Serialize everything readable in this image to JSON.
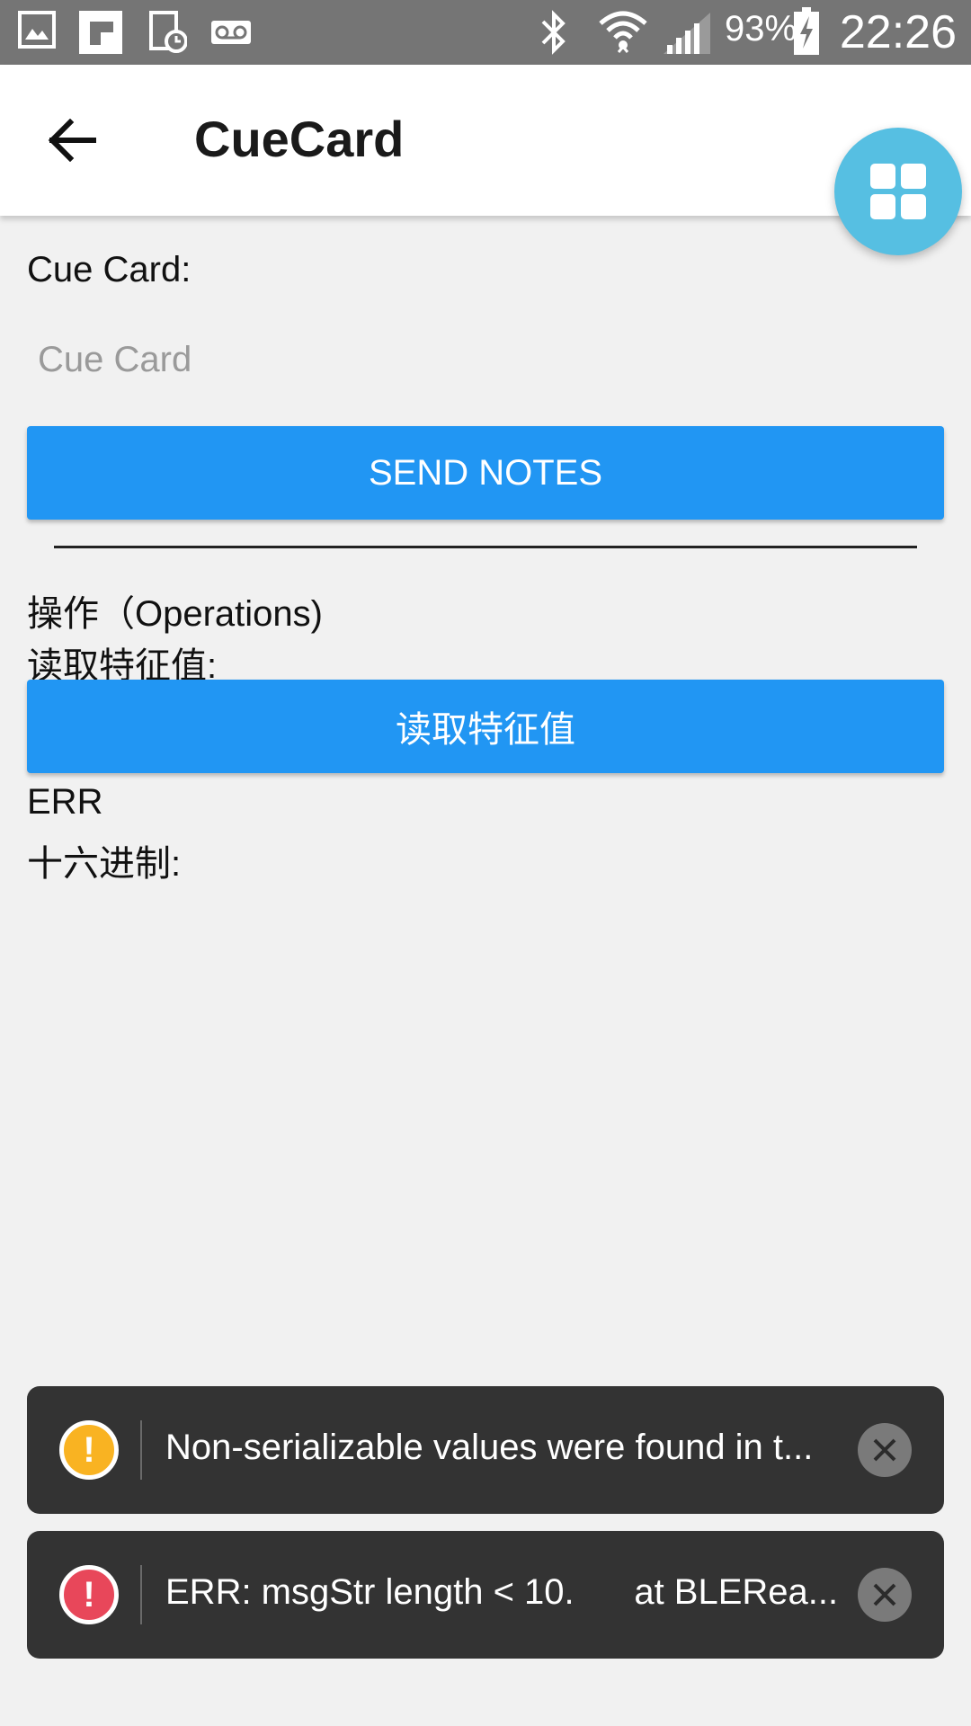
{
  "status_bar": {
    "battery": "93%",
    "time": "22:26",
    "left_icons": [
      "image-icon",
      "flipboard-icon",
      "clock-screen-icon",
      "voicemail-icon"
    ],
    "right_icons": [
      "bluetooth-icon",
      "wifi-icon",
      "signal-icon",
      "battery-charging-icon"
    ]
  },
  "app_bar": {
    "title": "CueCard",
    "back_icon": "arrow-left-icon",
    "fab_icon": "grid-icon",
    "fab_color": "#56bfe2"
  },
  "cue_card": {
    "label": "Cue Card:",
    "input_value": "",
    "input_placeholder": "Cue Card",
    "send_button": "SEND NOTES"
  },
  "operations": {
    "heading": "操作（Operations)",
    "read_label": "读取特征值:",
    "read_button": "读取特征值",
    "result": "ERR",
    "hex_label": "十六进制:"
  },
  "toasts": [
    {
      "type": "warning",
      "icon": "exclamation-icon",
      "color": "#f9b322",
      "message": "Non-serializable values were found in t..."
    },
    {
      "type": "error",
      "icon": "exclamation-icon",
      "color": "#e8475a",
      "message": "ERR: msgStr length < 10.      at BLERea..."
    }
  ],
  "colors": {
    "accent": "#2196f3",
    "background": "#f1f1f1",
    "status_bar": "#757575"
  }
}
